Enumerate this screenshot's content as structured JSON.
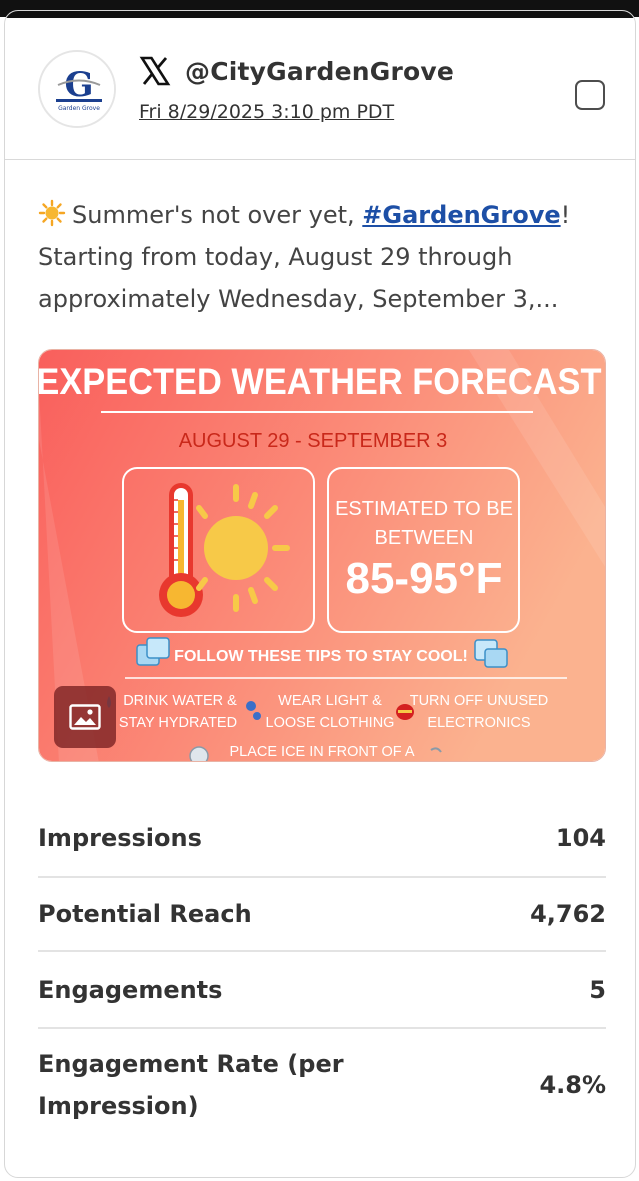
{
  "post": {
    "platform_icon": "x-logo-icon",
    "avatar_logo": "garden-grove-logo",
    "avatar_letter": "G",
    "avatar_text": "Garden Grove",
    "handle": "@CityGardenGrove",
    "timestamp": "Fri 8/29/2025 3:10 pm PDT",
    "text_intro": "Summer's not over yet, ",
    "hashtag": "#GardenGrove",
    "text_rest": "! Starting from today, August 29 through approximately Wednesday, September 3,..."
  },
  "media": {
    "title": "EXPECTED WEATHER FORECAST",
    "dates": "AUGUST 29 - SEPTEMBER 3",
    "estimate_line1": "ESTIMATED TO BE",
    "estimate_line2": "BETWEEN",
    "temperature": "85-95°F",
    "tips_heading": "FOLLOW THESE TIPS TO STAY COOL!",
    "tip1_line1": "DRINK WATER &",
    "tip1_line2": "STAY HYDRATED",
    "tip2_line1": "WEAR LIGHT &",
    "tip2_line2": "LOOSE CLOTHING",
    "tip3_line1": "TURN OFF UNUSED",
    "tip3_line2": "ELECTRONICS",
    "tip4_line1": "PLACE ICE IN FRONT OF A",
    "badge_icon": "image-icon",
    "colors": {
      "bg_left": "#f95f5c",
      "bg_right": "#fbb28f",
      "title": "#ffffff",
      "dates": "#c9281a"
    }
  },
  "stats": [
    {
      "label": "Impressions",
      "value": "104"
    },
    {
      "label": "Potential Reach",
      "value": "4,762"
    },
    {
      "label": "Engagements",
      "value": "5"
    },
    {
      "label": "Engagement Rate (per Impression)",
      "value": "4.8%"
    }
  ]
}
